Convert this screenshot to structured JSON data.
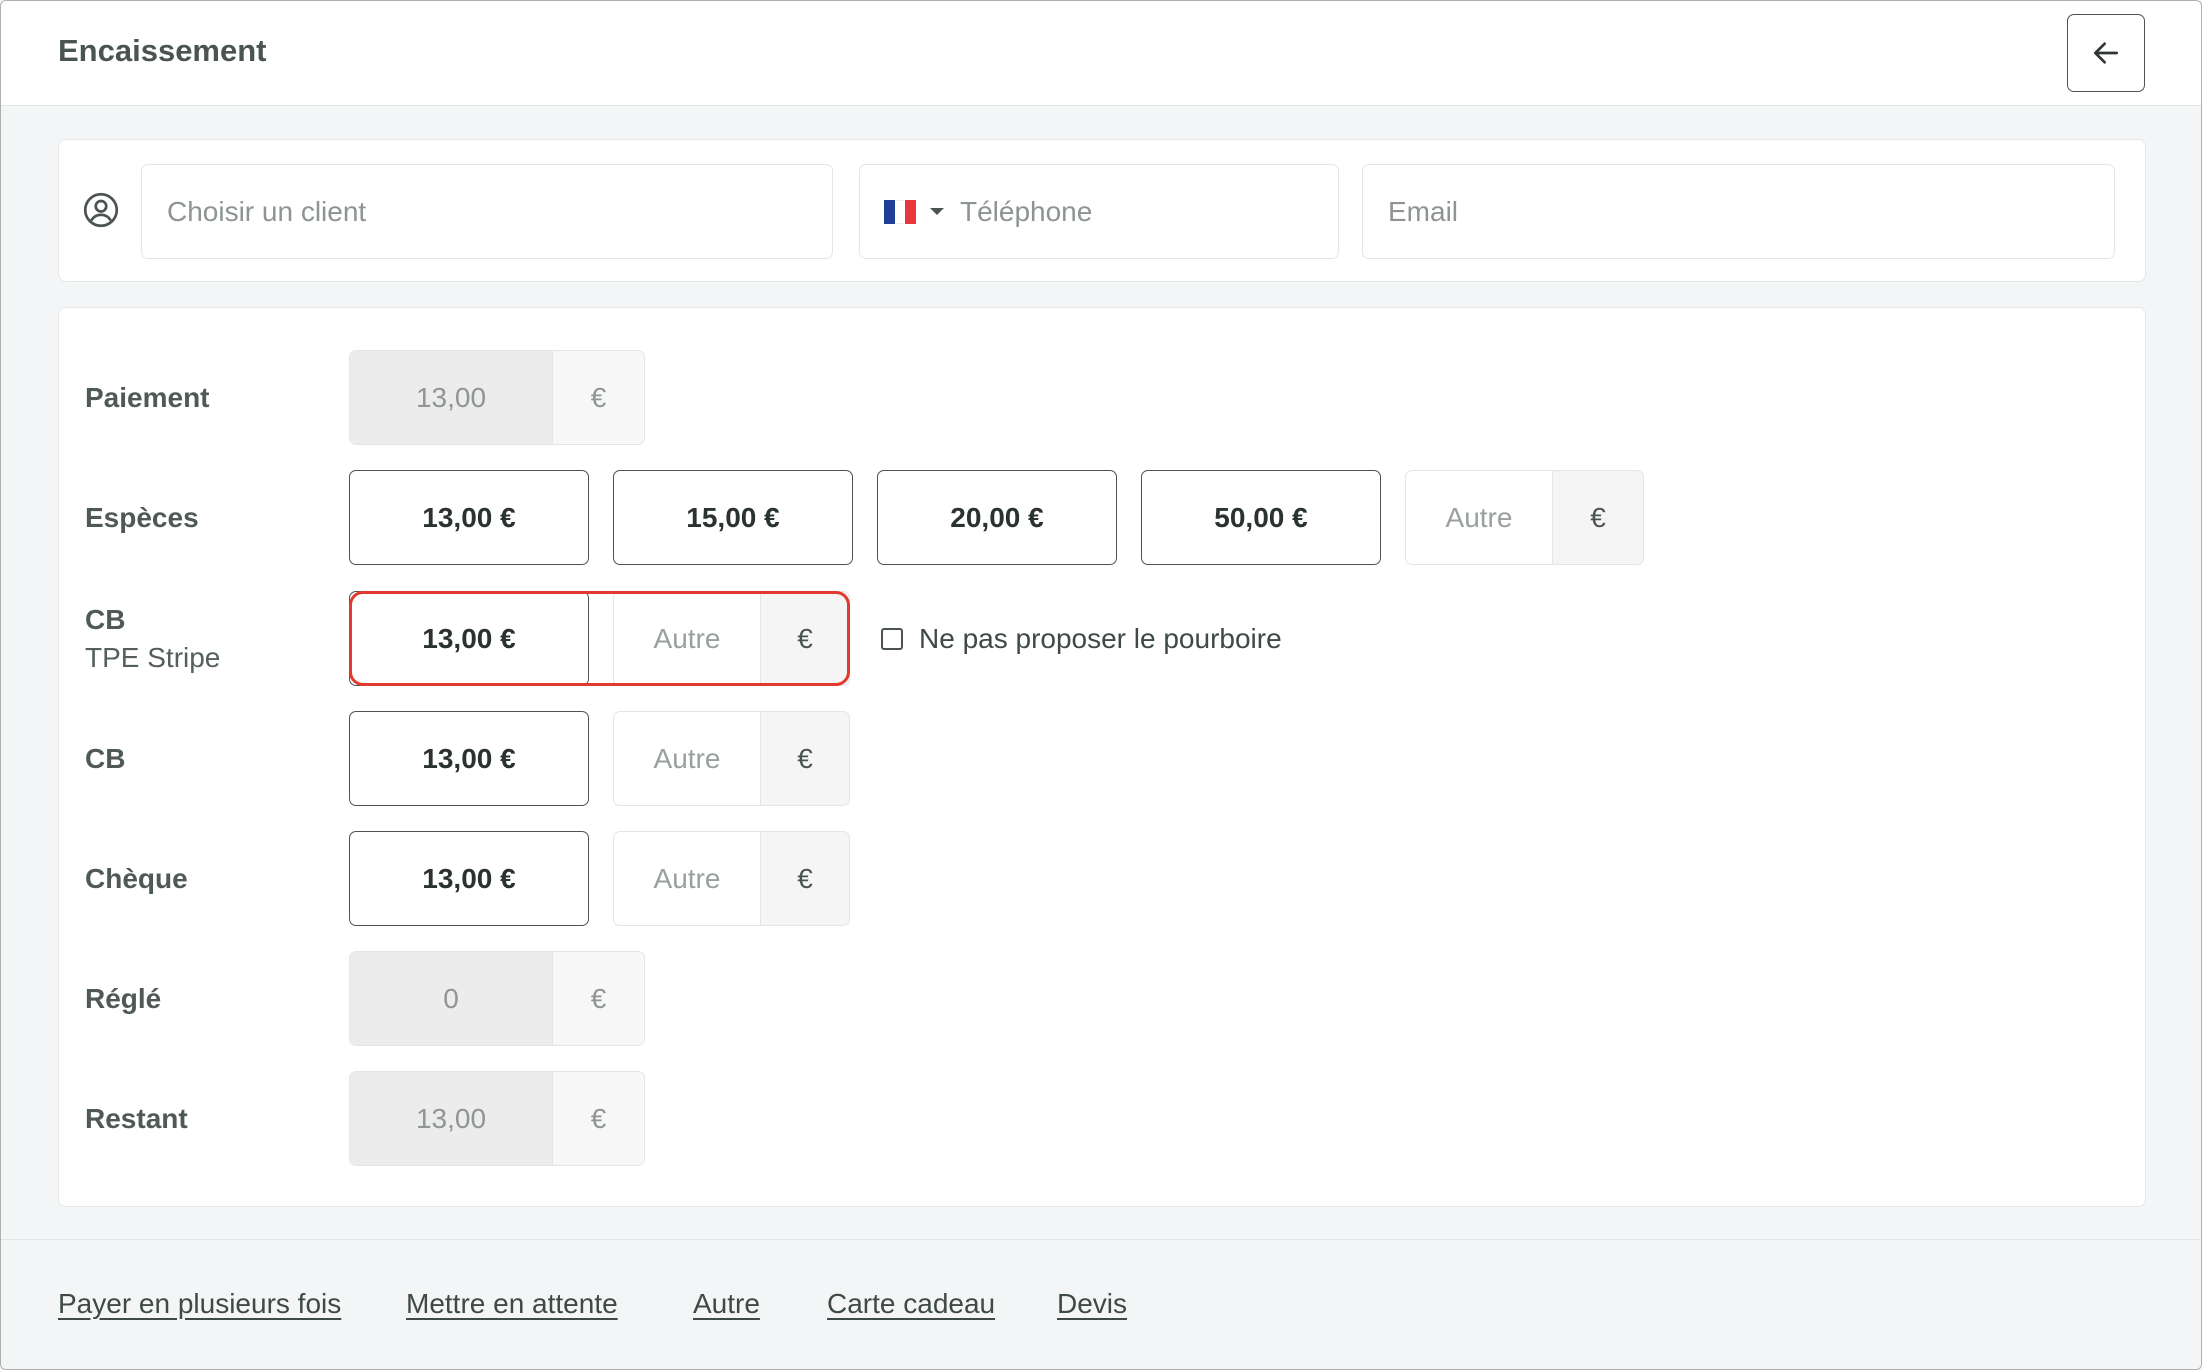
{
  "header": {
    "title": "Encaissement",
    "back_icon": "arrow-left-icon"
  },
  "client": {
    "client_placeholder": "Choisir un client",
    "phone_placeholder": "Téléphone",
    "email_placeholder": "Email",
    "flag_colors": [
      "#1f3f96",
      "#ffffff",
      "#e8383d"
    ]
  },
  "payment": {
    "paiement": {
      "label": "Paiement",
      "value": "13,00",
      "currency": "€"
    },
    "especes": {
      "label": "Espèces",
      "amounts": [
        "13,00 €",
        "15,00 €",
        "20,00 €",
        "50,00 €"
      ],
      "other_placeholder": "Autre",
      "currency": "€"
    },
    "cb_stripe": {
      "label": "CB",
      "sublabel": "TPE Stripe",
      "amount": "13,00 €",
      "other_placeholder": "Autre",
      "currency": "€",
      "tip_checkbox_label": "Ne pas proposer le pourboire"
    },
    "cb": {
      "label": "CB",
      "amount": "13,00 €",
      "other_placeholder": "Autre",
      "currency": "€"
    },
    "cheque": {
      "label": "Chèque",
      "amount": "13,00 €",
      "other_placeholder": "Autre",
      "currency": "€"
    },
    "regle": {
      "label": "Réglé",
      "value": "0",
      "currency": "€"
    },
    "restant": {
      "label": "Restant",
      "value": "13,00",
      "currency": "€"
    }
  },
  "footer": {
    "links": [
      "Payer en plusieurs fois",
      "Mettre en attente",
      "Autre",
      "Carte cadeau",
      "Devis"
    ]
  },
  "colors": {
    "highlight": "#e23a2f",
    "border_dark": "#4c5451",
    "background": "#f4f5f6"
  }
}
